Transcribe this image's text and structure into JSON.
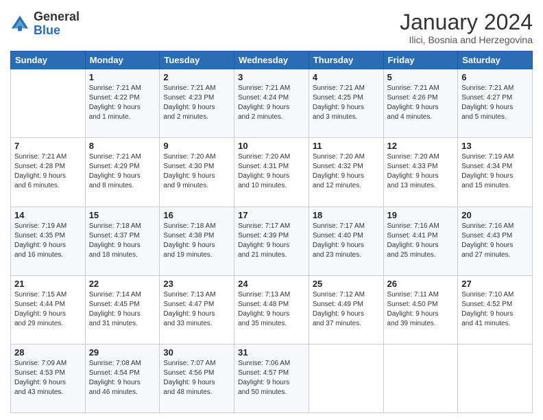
{
  "logo": {
    "general": "General",
    "blue": "Blue"
  },
  "header": {
    "month": "January 2024",
    "location": "Ilici, Bosnia and Herzegovina"
  },
  "weekdays": [
    "Sunday",
    "Monday",
    "Tuesday",
    "Wednesday",
    "Thursday",
    "Friday",
    "Saturday"
  ],
  "weeks": [
    [
      {
        "day": "",
        "content": ""
      },
      {
        "day": "1",
        "content": "Sunrise: 7:21 AM\nSunset: 4:22 PM\nDaylight: 9 hours\nand 1 minute."
      },
      {
        "day": "2",
        "content": "Sunrise: 7:21 AM\nSunset: 4:23 PM\nDaylight: 9 hours\nand 2 minutes."
      },
      {
        "day": "3",
        "content": "Sunrise: 7:21 AM\nSunset: 4:24 PM\nDaylight: 9 hours\nand 2 minutes."
      },
      {
        "day": "4",
        "content": "Sunrise: 7:21 AM\nSunset: 4:25 PM\nDaylight: 9 hours\nand 3 minutes."
      },
      {
        "day": "5",
        "content": "Sunrise: 7:21 AM\nSunset: 4:26 PM\nDaylight: 9 hours\nand 4 minutes."
      },
      {
        "day": "6",
        "content": "Sunrise: 7:21 AM\nSunset: 4:27 PM\nDaylight: 9 hours\nand 5 minutes."
      }
    ],
    [
      {
        "day": "7",
        "content": "Sunrise: 7:21 AM\nSunset: 4:28 PM\nDaylight: 9 hours\nand 6 minutes."
      },
      {
        "day": "8",
        "content": "Sunrise: 7:21 AM\nSunset: 4:29 PM\nDaylight: 9 hours\nand 8 minutes."
      },
      {
        "day": "9",
        "content": "Sunrise: 7:20 AM\nSunset: 4:30 PM\nDaylight: 9 hours\nand 9 minutes."
      },
      {
        "day": "10",
        "content": "Sunrise: 7:20 AM\nSunset: 4:31 PM\nDaylight: 9 hours\nand 10 minutes."
      },
      {
        "day": "11",
        "content": "Sunrise: 7:20 AM\nSunset: 4:32 PM\nDaylight: 9 hours\nand 12 minutes."
      },
      {
        "day": "12",
        "content": "Sunrise: 7:20 AM\nSunset: 4:33 PM\nDaylight: 9 hours\nand 13 minutes."
      },
      {
        "day": "13",
        "content": "Sunrise: 7:19 AM\nSunset: 4:34 PM\nDaylight: 9 hours\nand 15 minutes."
      }
    ],
    [
      {
        "day": "14",
        "content": "Sunrise: 7:19 AM\nSunset: 4:35 PM\nDaylight: 9 hours\nand 16 minutes."
      },
      {
        "day": "15",
        "content": "Sunrise: 7:18 AM\nSunset: 4:37 PM\nDaylight: 9 hours\nand 18 minutes."
      },
      {
        "day": "16",
        "content": "Sunrise: 7:18 AM\nSunset: 4:38 PM\nDaylight: 9 hours\nand 19 minutes."
      },
      {
        "day": "17",
        "content": "Sunrise: 7:17 AM\nSunset: 4:39 PM\nDaylight: 9 hours\nand 21 minutes."
      },
      {
        "day": "18",
        "content": "Sunrise: 7:17 AM\nSunset: 4:40 PM\nDaylight: 9 hours\nand 23 minutes."
      },
      {
        "day": "19",
        "content": "Sunrise: 7:16 AM\nSunset: 4:41 PM\nDaylight: 9 hours\nand 25 minutes."
      },
      {
        "day": "20",
        "content": "Sunrise: 7:16 AM\nSunset: 4:43 PM\nDaylight: 9 hours\nand 27 minutes."
      }
    ],
    [
      {
        "day": "21",
        "content": "Sunrise: 7:15 AM\nSunset: 4:44 PM\nDaylight: 9 hours\nand 29 minutes."
      },
      {
        "day": "22",
        "content": "Sunrise: 7:14 AM\nSunset: 4:45 PM\nDaylight: 9 hours\nand 31 minutes."
      },
      {
        "day": "23",
        "content": "Sunrise: 7:13 AM\nSunset: 4:47 PM\nDaylight: 9 hours\nand 33 minutes."
      },
      {
        "day": "24",
        "content": "Sunrise: 7:13 AM\nSunset: 4:48 PM\nDaylight: 9 hours\nand 35 minutes."
      },
      {
        "day": "25",
        "content": "Sunrise: 7:12 AM\nSunset: 4:49 PM\nDaylight: 9 hours\nand 37 minutes."
      },
      {
        "day": "26",
        "content": "Sunrise: 7:11 AM\nSunset: 4:50 PM\nDaylight: 9 hours\nand 39 minutes."
      },
      {
        "day": "27",
        "content": "Sunrise: 7:10 AM\nSunset: 4:52 PM\nDaylight: 9 hours\nand 41 minutes."
      }
    ],
    [
      {
        "day": "28",
        "content": "Sunrise: 7:09 AM\nSunset: 4:53 PM\nDaylight: 9 hours\nand 43 minutes."
      },
      {
        "day": "29",
        "content": "Sunrise: 7:08 AM\nSunset: 4:54 PM\nDaylight: 9 hours\nand 46 minutes."
      },
      {
        "day": "30",
        "content": "Sunrise: 7:07 AM\nSunset: 4:56 PM\nDaylight: 9 hours\nand 48 minutes."
      },
      {
        "day": "31",
        "content": "Sunrise: 7:06 AM\nSunset: 4:57 PM\nDaylight: 9 hours\nand 50 minutes."
      },
      {
        "day": "",
        "content": ""
      },
      {
        "day": "",
        "content": ""
      },
      {
        "day": "",
        "content": ""
      }
    ]
  ]
}
